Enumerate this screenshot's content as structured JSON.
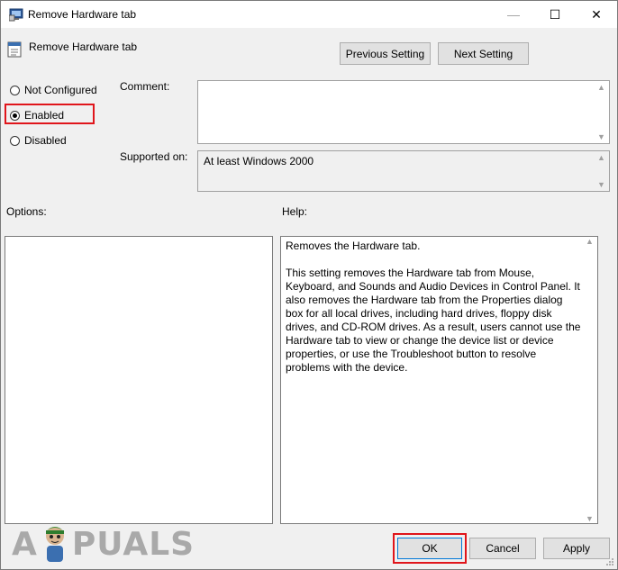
{
  "window": {
    "title": "Remove Hardware tab",
    "controls": {
      "minimize": "—",
      "maximize": "☐",
      "close": "✕"
    }
  },
  "header": {
    "title": "Remove Hardware tab",
    "previous_label": "Previous Setting",
    "next_label": "Next Setting"
  },
  "state": {
    "options": [
      {
        "label": "Not Configured",
        "checked": false
      },
      {
        "label": "Enabled",
        "checked": true
      },
      {
        "label": "Disabled",
        "checked": false
      }
    ]
  },
  "fields": {
    "comment_label": "Comment:",
    "comment_value": "",
    "supported_label": "Supported on:",
    "supported_value": "At least Windows 2000"
  },
  "panels": {
    "options_label": "Options:",
    "help_label": "Help:",
    "help_text": "Removes the Hardware tab.\n\nThis setting removes the Hardware tab from Mouse, Keyboard, and Sounds and Audio Devices in Control Panel. It also removes the Hardware tab from the Properties dialog box for all local drives, including hard drives, floppy disk drives, and CD-ROM drives. As a result, users cannot use the Hardware tab to view or change the device list or device properties, or use the Troubleshoot button to resolve problems with the device."
  },
  "footer": {
    "ok_label": "OK",
    "cancel_label": "Cancel",
    "apply_label": "Apply"
  },
  "watermark": {
    "text_left": "A",
    "text_right": "PUALS"
  },
  "colors": {
    "highlight": "#e0151b",
    "accent": "#0078d7"
  }
}
